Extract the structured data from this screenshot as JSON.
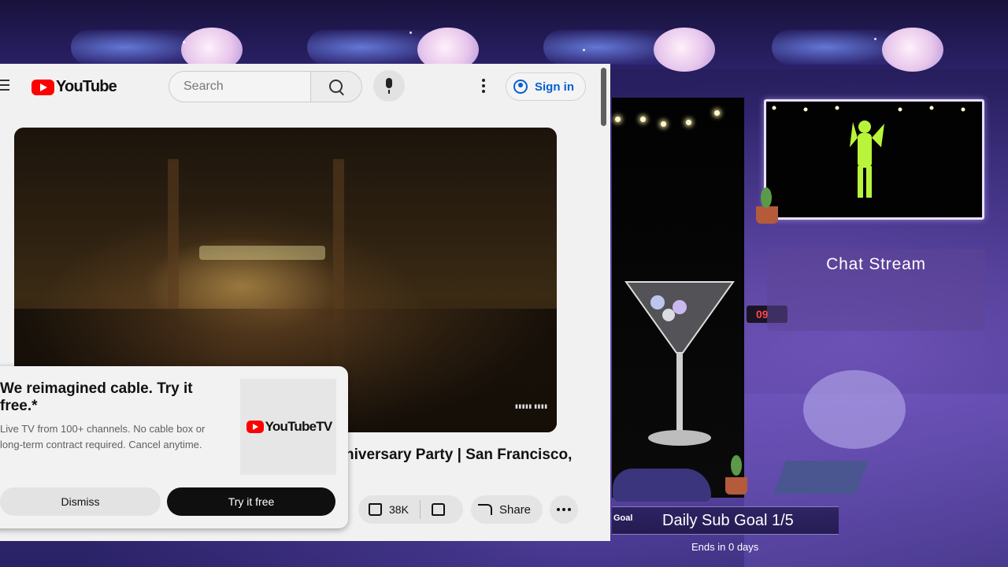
{
  "youtube": {
    "logo_text": "YouTube",
    "search": {
      "placeholder": "Search"
    },
    "sign_in_label": "Sign in",
    "video": {
      "title": "niversary Party | San Francisco,",
      "likes": "38K",
      "share_label": "Share"
    },
    "promo": {
      "title": "We reimagined cable. Try it free.*",
      "description": "Live TV from 100+ channels. No cable box or long-term contract required. Cancel anytime.",
      "logo_text": "YouTubeTV",
      "dismiss_label": "Dismiss",
      "try_label": "Try it free"
    },
    "colors": {
      "brand_red": "#ff0000",
      "link_blue": "#065fd4"
    }
  },
  "overlay": {
    "chat_title": "Chat Stream",
    "goal_tag": "Goal",
    "goal_text": "Daily Sub Goal 1/5",
    "goal_ends": "Ends in 0 days",
    "clock_text": "09"
  }
}
